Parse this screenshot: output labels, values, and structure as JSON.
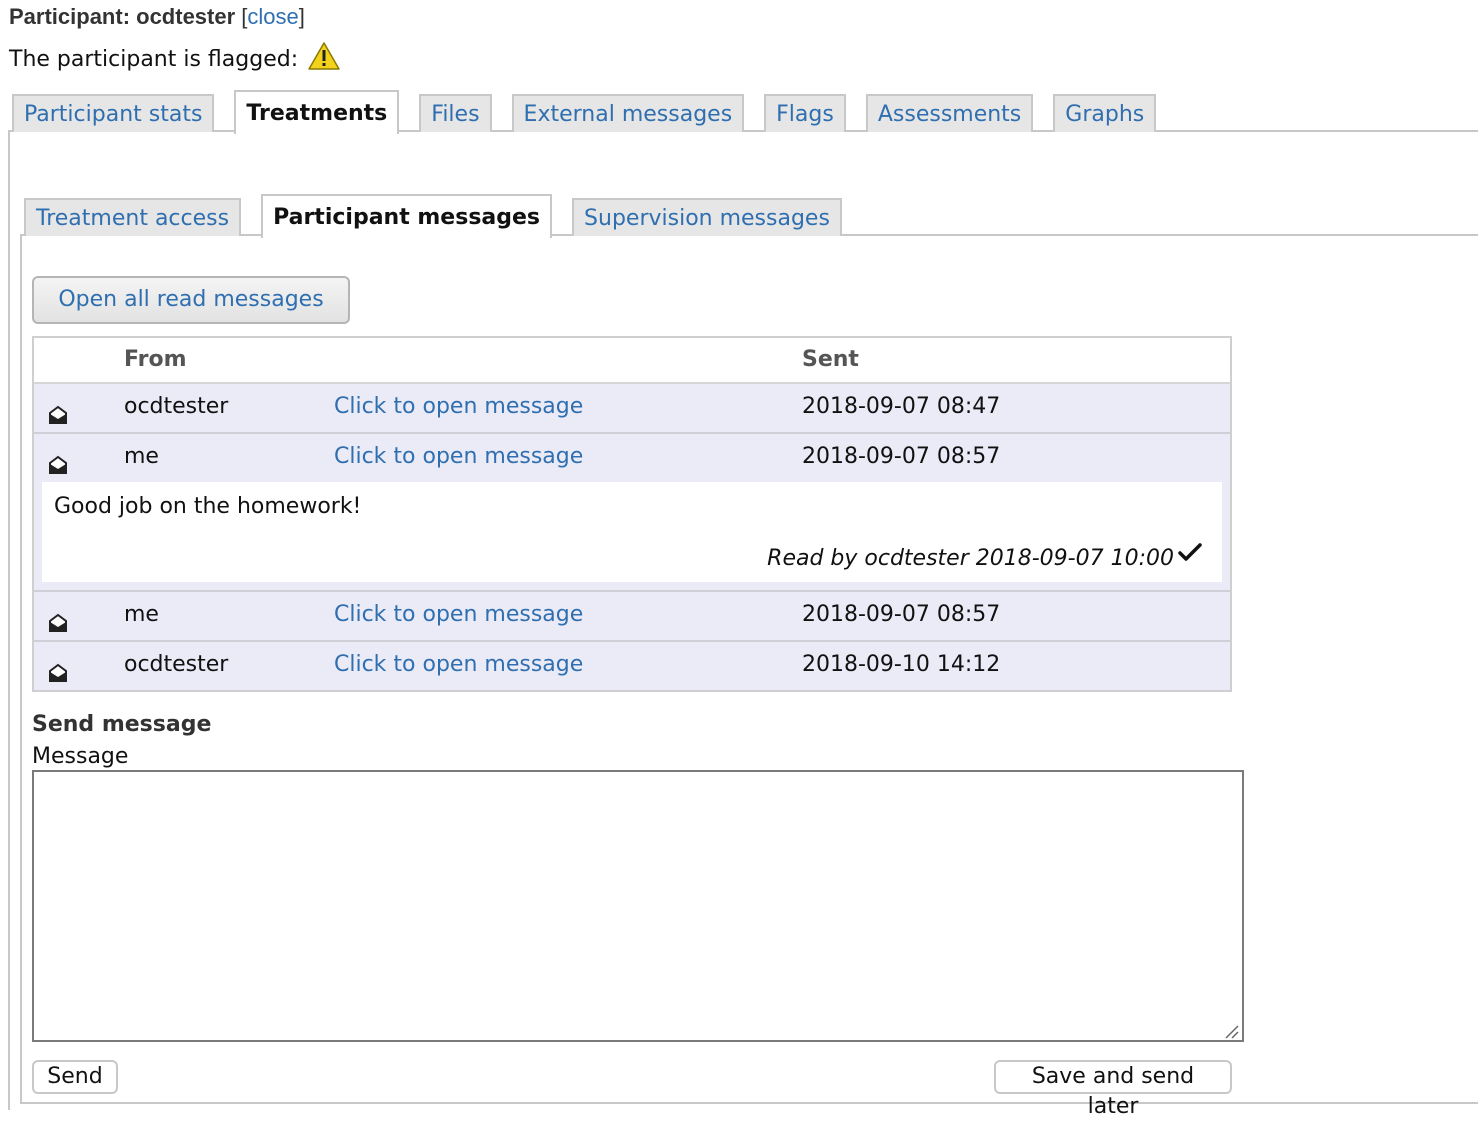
{
  "header": {
    "title_prefix": "Participant: ocdtester",
    "close_label": "close",
    "flagged_text": "The participant is flagged:"
  },
  "outer_tabs": [
    {
      "label": "Participant stats",
      "active": false
    },
    {
      "label": "Treatments",
      "active": true
    },
    {
      "label": "Files",
      "active": false
    },
    {
      "label": "External messages",
      "active": false
    },
    {
      "label": "Flags",
      "active": false
    },
    {
      "label": "Assessments",
      "active": false
    },
    {
      "label": "Graphs",
      "active": false
    }
  ],
  "inner_tabs": [
    {
      "label": "Treatment access",
      "active": false
    },
    {
      "label": "Participant messages",
      "active": true
    },
    {
      "label": "Supervision messages",
      "active": false
    }
  ],
  "open_all_label": "Open all read messages",
  "table": {
    "headers": {
      "from": "From",
      "sent": "Sent"
    },
    "rows": [
      {
        "from": "ocdtester",
        "link": "Click to open message",
        "sent": "2018-09-07 08:47"
      },
      {
        "from": "me",
        "link": "Click to open message",
        "sent": "2018-09-07 08:57"
      },
      {
        "from": "me",
        "link": "Click to open message",
        "sent": "2018-09-07 08:57"
      },
      {
        "from": "ocdtester",
        "link": "Click to open message",
        "sent": "2018-09-10 14:12"
      }
    ],
    "expanded": {
      "body": "Good job on the homework!",
      "read_by": "Read by ocdtester 2018-09-07 10:00"
    }
  },
  "send": {
    "heading": "Send message",
    "message_label": "Message",
    "message_value": "",
    "send_label": "Send",
    "later_label": "Save and send later"
  },
  "colors": {
    "link": "#2f6fb0",
    "row_background": "#ebebf8",
    "warning_icon": "#f2d21b"
  },
  "icons": {
    "warning": "warning-triangle-icon",
    "envelope": "envelope-open-icon",
    "check": "checkmark-icon"
  }
}
